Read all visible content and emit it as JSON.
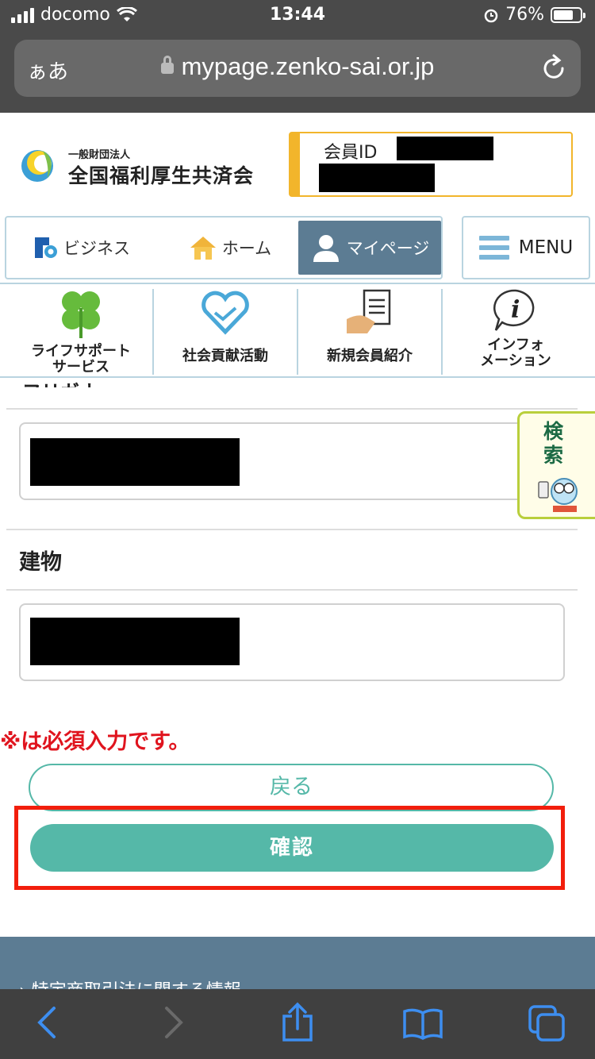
{
  "status_bar": {
    "carrier": "docomo",
    "time": "13:44",
    "battery": "76%",
    "battery_level": 0.76
  },
  "browser": {
    "text_size_label": "ぁあ",
    "url": "mypage.zenko-sai.or.jp"
  },
  "header": {
    "org_prefix": "一般財団法人",
    "org_name": "全国福利厚生共済会",
    "member_label": "会員ID"
  },
  "nav": {
    "business": "ビジネス",
    "home": "ホーム",
    "mypage": "マイページ",
    "menu": "MENU"
  },
  "services": [
    {
      "line1": "ライフサポート",
      "line2": "サービス"
    },
    {
      "line1": "社会貢献活動",
      "line2": ""
    },
    {
      "line1": "新規会員紹介",
      "line2": ""
    },
    {
      "line1": "インフォ",
      "line2": "メーション"
    }
  ],
  "form": {
    "cut_label": "フリガナ",
    "building_label": "建物",
    "required_note": "※は必須入力です。"
  },
  "buttons": {
    "back": "戻る",
    "confirm": "確認"
  },
  "search_tab": {
    "label": "検索"
  },
  "footer": {
    "link": "特定商取引法に関する情報"
  },
  "colors": {
    "accent_teal": "#55b8a8",
    "nav_active": "#5c7c93",
    "highlight": "#f21e0c",
    "member_gold": "#f2b52b"
  }
}
